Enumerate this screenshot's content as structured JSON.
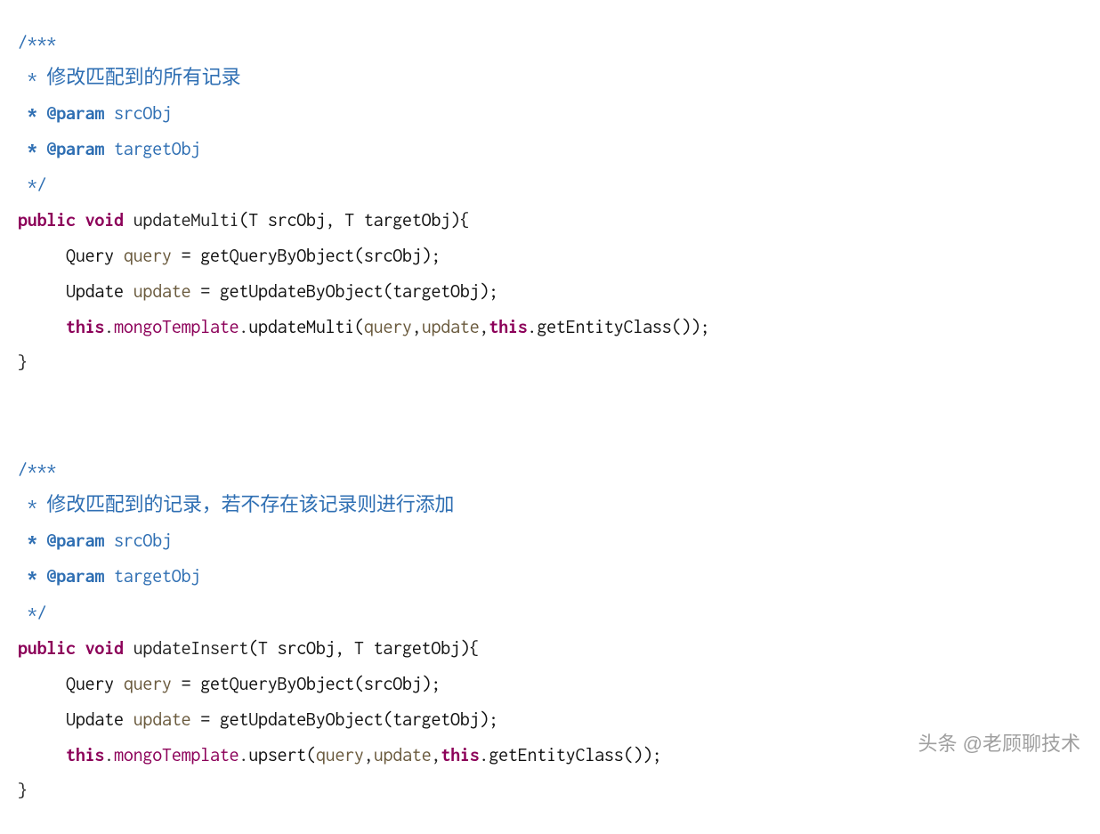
{
  "code": {
    "method1": {
      "doc_open": "/***",
      "doc_desc": " * 修改匹配到的所有记录",
      "doc_param1_tag": " * @param",
      "doc_param1_name": " srcObj",
      "doc_param2_tag": " * @param",
      "doc_param2_name": " targetObj",
      "doc_close": " */",
      "sig_kw1": "public",
      "sig_kw2": "void",
      "sig_name": " updateMulti",
      "sig_params": "(T srcObj, T targetObj){",
      "l1_type": "Query",
      "l1_var": " query",
      "l1_rest": " = getQueryByObject(srcObj);",
      "l2_type": "Update",
      "l2_var": " update",
      "l2_rest": " = getUpdateByObject(targetObj);",
      "l3_this": "this",
      "l3_dot1": ".",
      "l3_field": "mongoTemplate",
      "l3_dot2": ".",
      "l3_call": "updateMulti(",
      "l3_arg1": "query",
      "l3_c1": ",",
      "l3_arg2": "update",
      "l3_c2": ",",
      "l3_this2": "this",
      "l3_tail": ".getEntityClass());",
      "close": "}"
    },
    "method2": {
      "doc_open": "/***",
      "doc_desc": " * 修改匹配到的记录，若不存在该记录则进行添加",
      "doc_param1_tag": " * @param",
      "doc_param1_name": " srcObj",
      "doc_param2_tag": " * @param",
      "doc_param2_name": " targetObj",
      "doc_close": " */",
      "sig_kw1": "public",
      "sig_kw2": "void",
      "sig_name": " updateInsert",
      "sig_params": "(T srcObj, T targetObj){",
      "l1_type": "Query",
      "l1_var": " query",
      "l1_rest": " = getQueryByObject(srcObj);",
      "l2_type": "Update",
      "l2_var": " update",
      "l2_rest": " = getUpdateByObject(targetObj);",
      "l3_this": "this",
      "l3_dot1": ".",
      "l3_field": "mongoTemplate",
      "l3_dot2": ".",
      "l3_call": "upsert(",
      "l3_arg1": "query",
      "l3_c1": ",",
      "l3_arg2": "update",
      "l3_c2": ",",
      "l3_this2": "this",
      "l3_tail": ".getEntityClass());",
      "close": "}"
    }
  },
  "watermark": "头条 @老顾聊技术"
}
